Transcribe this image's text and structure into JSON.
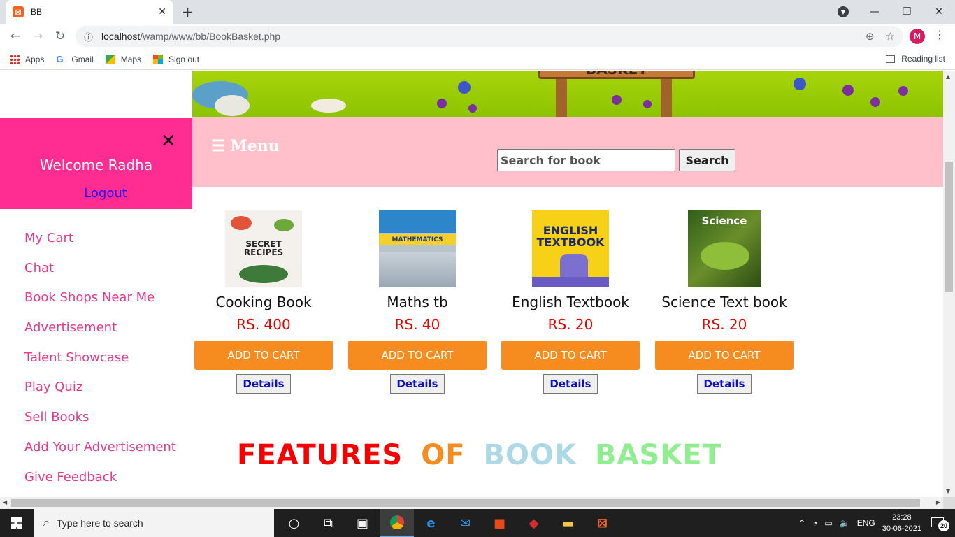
{
  "browser": {
    "tab_title": "BB",
    "url_host": "localhost",
    "url_path": "/wamp/www/bb/BookBasket.php",
    "profile_initial": "M",
    "bookmarks": [
      "Apps",
      "Gmail",
      "Maps",
      "Sign out"
    ],
    "reading_list": "Reading list"
  },
  "banner": {
    "sign_text": "BASKET"
  },
  "menu": {
    "menu_label": "☰ Menu",
    "search_placeholder": "Search for book",
    "search_button": "Search"
  },
  "sidebar": {
    "welcome": "Welcome Radha",
    "logout": "Logout",
    "links": [
      "My Cart",
      "Chat",
      "Book Shops Near Me",
      "Advertisement",
      "Talent Showcase",
      "Play Quiz",
      "Sell Books",
      "Add Your Advertisement",
      "Give Feedback"
    ]
  },
  "products": [
    {
      "name": "Cooking Book",
      "price": "RS. 400",
      "cart": "ADD TO CART",
      "details": "Details",
      "cover_text": "SECRET RECIPES",
      "cover_color": "#f4f1ec"
    },
    {
      "name": "Maths tb",
      "price": "RS. 40",
      "cart": "ADD TO CART",
      "details": "Details",
      "cover_text": "MATHEMATICS",
      "cover_color": "#2c86c9"
    },
    {
      "name": "English Textbook",
      "price": "RS. 20",
      "cart": "ADD TO CART",
      "details": "Details",
      "cover_text": "ENGLISH TEXTBOOK",
      "cover_color": "#f7d117"
    },
    {
      "name": "Science Text book",
      "price": "RS. 20",
      "cart": "ADD TO CART",
      "details": "Details",
      "cover_text": "Science",
      "cover_color": "#3f6b1d"
    }
  ],
  "features": {
    "words": [
      "FEATURES",
      "OF",
      "BOOK",
      "BASKET"
    ],
    "colors": [
      "#f40000",
      "#f68b1f",
      "#add8e6",
      "#90ee90"
    ]
  },
  "taskbar": {
    "search_placeholder": "Type here to search",
    "language": "ENG",
    "time": "23:28",
    "date": "30-06-2021",
    "notifications": "20"
  },
  "colors": {
    "accent_pink": "#ff2d92",
    "menu_bg": "#ffc0cb",
    "cart_button": "#f68b1f",
    "price_red": "#e60000",
    "link_pink": "#e8388a"
  }
}
